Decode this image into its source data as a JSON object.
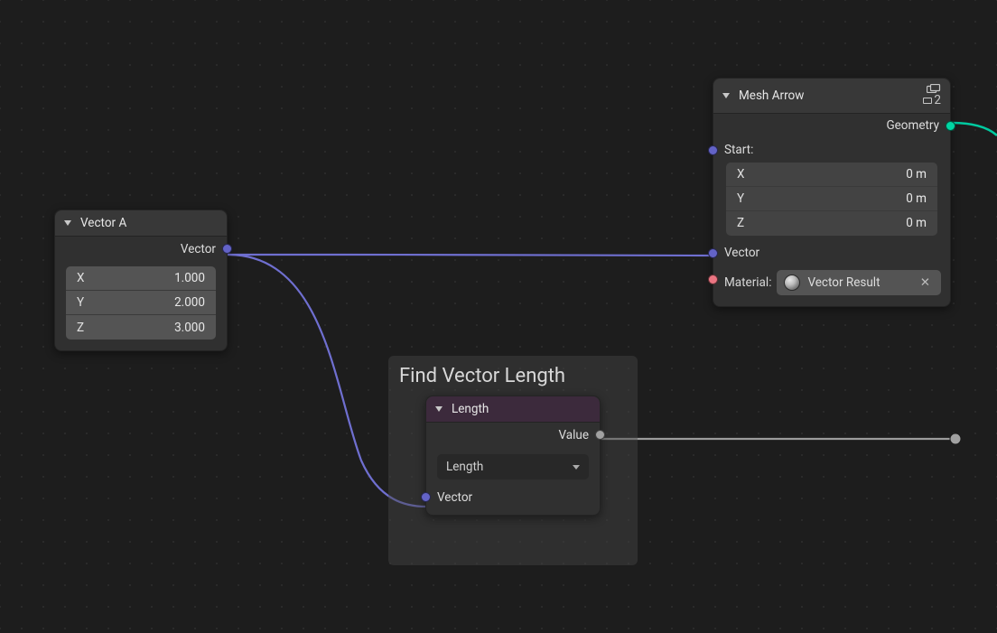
{
  "frame": {
    "title": "Find Vector Length"
  },
  "vectorA": {
    "title": "Vector A",
    "output": "Vector",
    "fields": [
      {
        "k": "X",
        "v": "1.000"
      },
      {
        "k": "Y",
        "v": "2.000"
      },
      {
        "k": "Z",
        "v": "3.000"
      }
    ]
  },
  "length": {
    "title": "Length",
    "output": "Value",
    "mode": "Length",
    "input": "Vector"
  },
  "meshArrow": {
    "title": "Mesh Arrow",
    "users": "2",
    "outGeom": "Geometry",
    "startLabel": "Start:",
    "fields": [
      {
        "k": "X",
        "v": "0 m"
      },
      {
        "k": "Y",
        "v": "0 m"
      },
      {
        "k": "Z",
        "v": "0 m"
      }
    ],
    "inVector": "Vector",
    "matLabel": "Material:",
    "matValue": "Vector Result"
  }
}
